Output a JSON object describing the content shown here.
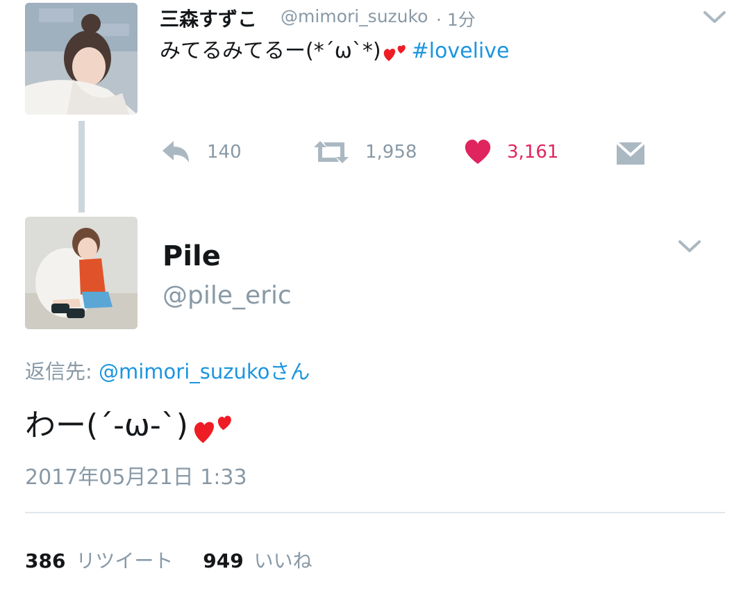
{
  "original_tweet": {
    "display_name": "三森すずこ",
    "handle": "@mimori_suzuko",
    "time": "· 1分",
    "text": "みてるみてるー(*´ω`*)",
    "hashtag": "#lovelive",
    "actions": {
      "reply_count": "140",
      "retweet_count": "1,958",
      "like_count": "3,161"
    }
  },
  "reply_tweet": {
    "display_name": "Pile",
    "handle": "@pile_eric",
    "reply_to_label": "返信先:",
    "reply_to_handle": "@mimori_suzukoさん",
    "text": "わー(´-ω-`)",
    "timestamp": "2017年05月21日 1:33",
    "stats": {
      "retweets": "386",
      "retweets_label": "リツイート",
      "likes": "949",
      "likes_label": "いいね"
    }
  },
  "colors": {
    "accent_blue": "#1b95e0",
    "like_red": "#e0245e",
    "grey_text": "#8899a6",
    "icon_grey": "#aab8c2"
  },
  "icons": [
    "chevron-down-icon",
    "reply-icon",
    "retweet-icon",
    "heart-icon",
    "message-icon",
    "two-hearts-emoji"
  ]
}
